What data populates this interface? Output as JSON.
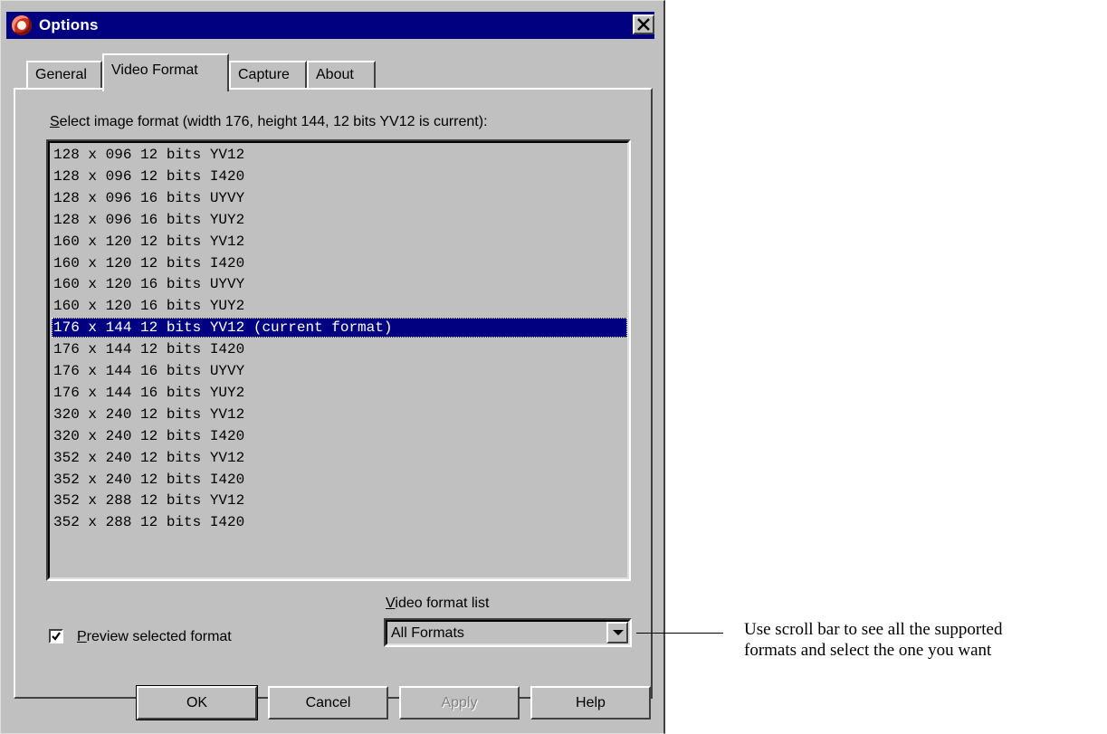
{
  "window": {
    "title": "Options",
    "close_glyph": "✕"
  },
  "tabs": [
    {
      "label": "General",
      "active": false
    },
    {
      "label": "Video Format",
      "active": true
    },
    {
      "label": "Capture",
      "active": false
    },
    {
      "label": "About",
      "active": false
    }
  ],
  "video_format": {
    "select_label_key": "S",
    "select_label_rest": "elect image format (width 176, height 144, 12 bits YV12 is current):",
    "formats": [
      "128 x 096 12 bits YV12",
      "128 x 096 12 bits I420",
      "128 x 096 16 bits UYVY",
      "128 x 096 16 bits YUY2",
      "160 x 120 12 bits YV12",
      "160 x 120 12 bits I420",
      "160 x 120 16 bits UYVY",
      "160 x 120 16 bits YUY2",
      "176 x 144 12 bits YV12 (current format)",
      "176 x 144 12 bits I420",
      "176 x 144 16 bits UYVY",
      "176 x 144 16 bits YUY2",
      "320 x 240 12 bits YV12",
      "320 x 240 12 bits I420",
      "352 x 240 12 bits YV12",
      "352 x 240 12 bits I420",
      "352 x 288 12 bits YV12",
      "352 x 288 12 bits I420"
    ],
    "selected_index": 8,
    "list_label_key": "V",
    "list_label_rest": "ideo format list",
    "list_value": "All Formats",
    "preview_checked": true,
    "preview_label_key": "P",
    "preview_label_rest": "review selected format"
  },
  "buttons": {
    "ok": "OK",
    "cancel": "Cancel",
    "apply": "Apply",
    "help": "Help"
  },
  "annotation": {
    "line1": "Use scroll bar to see all the supported",
    "line2": "formats and select the one you want"
  }
}
